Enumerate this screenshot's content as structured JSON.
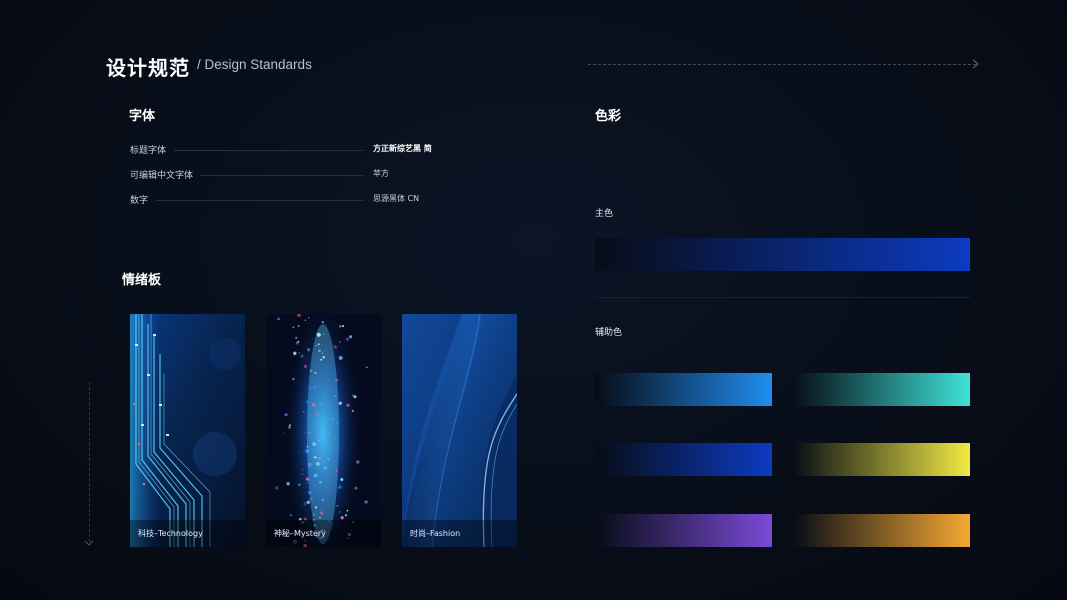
{
  "header": {
    "title": "设计规范",
    "subtitle": "/ Design Standards"
  },
  "fonts": {
    "heading": "字体",
    "rows": [
      {
        "label": "标题字体",
        "value": "方正新综艺黑 简"
      },
      {
        "label": "可编辑中文字体",
        "value": "苹方"
      },
      {
        "label": "数字",
        "value": "思源黑体 CN"
      }
    ]
  },
  "moodboard": {
    "heading": "情绪板",
    "cards": [
      {
        "caption": "科技–Technology"
      },
      {
        "caption": "神秘–Mystery"
      },
      {
        "caption": "时尚–Fashion"
      }
    ]
  },
  "colors": {
    "heading": "色彩",
    "primary_label": "主色",
    "primary": {
      "from": "#070c16",
      "to": "#0c3bc2"
    },
    "secondary_label": "辅助色",
    "secondary": [
      {
        "from": "#070c16",
        "to": "#1f8df0"
      },
      {
        "from": "#070c16",
        "to": "#3ee3d8"
      },
      {
        "from": "#070c16",
        "to": "#0c3bc2"
      },
      {
        "from": "#070c16",
        "to": "#f2ea44"
      },
      {
        "from": "#070c16",
        "to": "#7a4bd6"
      },
      {
        "from": "#070c16",
        "to": "#f5a833"
      }
    ]
  },
  "icons": {
    "header_arrow": "chevron-right-icon",
    "side_arrow": "chevron-down-icon"
  }
}
